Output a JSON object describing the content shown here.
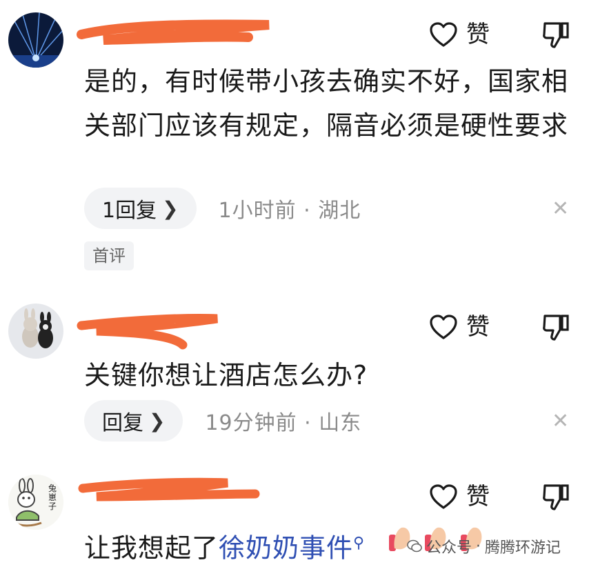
{
  "comments": [
    {
      "like_label": "赞",
      "text": "是的，有时候带小孩去确实不好，国家相关部门应该有规定，隔音必须是硬性要求",
      "reply_label": "1回复",
      "meta": "1小时前 · 湖北",
      "tag": "首评"
    },
    {
      "like_label": "赞",
      "text": "关键你想让酒店怎么办?",
      "reply_label": "回复",
      "meta": "19分钟前 · 山东"
    },
    {
      "like_label": "赞",
      "text_prefix": "让我想起了",
      "text_link": "徐奶奶事件",
      "avatar_text": "兔崽子"
    }
  ],
  "watermark": {
    "source": "公众号",
    "author": "腾腾环游记"
  },
  "colors": {
    "redaction": "#f26b3a",
    "link": "#2f4fb3",
    "pill_bg": "#f2f3f5",
    "meta_text": "#8a8a8a"
  },
  "icons": {
    "like": "heart-outline-icon",
    "dislike": "thumbs-down-icon",
    "reply_chevron": "chevron-right-icon",
    "close": "close-icon",
    "search": "search-icon"
  }
}
